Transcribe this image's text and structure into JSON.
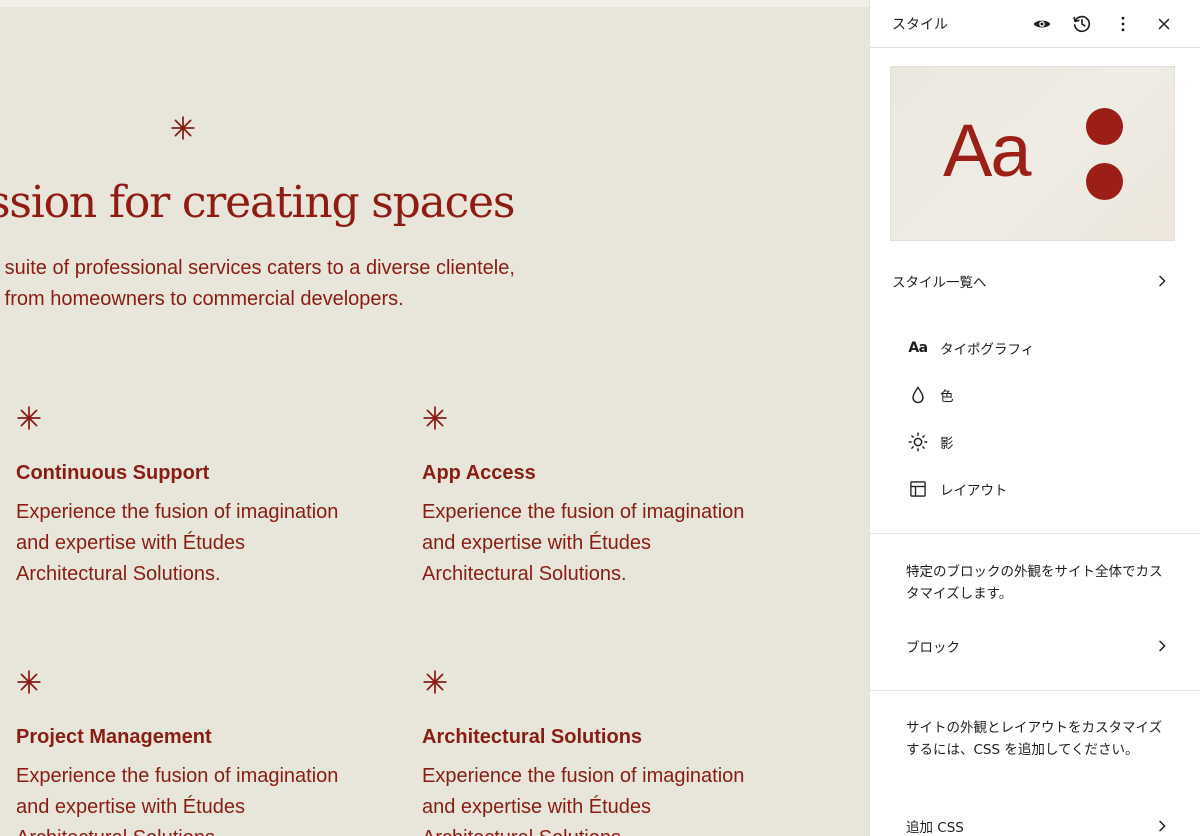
{
  "canvas": {
    "hero_title": "ssion for creating spaces",
    "hero_desc_line1": "e suite of professional services caters to a diverse clientele,",
    "hero_desc_line2": "g from homeowners to commercial developers.",
    "features": [
      {
        "title": "Continuous Support",
        "text": "Experience the fusion of imagination and expertise with Études Architectural Solutions."
      },
      {
        "title": "App Access",
        "text": "Experience the fusion of imagination and expertise with Études Architectural Solutions."
      },
      {
        "title": "Project Management",
        "text": "Experience the fusion of imagination and expertise with Études Architectural Solutions."
      },
      {
        "title": "Architectural Solutions",
        "text": "Experience the fusion of imagination and expertise with Études Architectural Solutions."
      }
    ],
    "accent_color": "#8a1c14",
    "background_color": "#e8e5da"
  },
  "sidebar": {
    "title": "スタイル",
    "header_icons": [
      "eye-icon",
      "history-icon",
      "more-vertical-icon",
      "close-icon"
    ],
    "preview": {
      "text": "Aa",
      "accent_color": "#9b1f16"
    },
    "browse_styles_label": "スタイル一覧へ",
    "menu": [
      {
        "icon": "typography-icon",
        "icon_text": "Aa",
        "label": "タイポグラフィ"
      },
      {
        "icon": "color-drop-icon",
        "label": "色"
      },
      {
        "icon": "shadow-sun-icon",
        "label": "影"
      },
      {
        "icon": "layout-icon",
        "label": "レイアウト"
      }
    ],
    "blocks_desc": "特定のブロックの外観をサイト全体でカスタマイズします。",
    "blocks_label": "ブロック",
    "css_desc": "サイトの外観とレイアウトをカスタマイズするには、CSS を追加してください。",
    "css_label": "追加 CSS"
  }
}
